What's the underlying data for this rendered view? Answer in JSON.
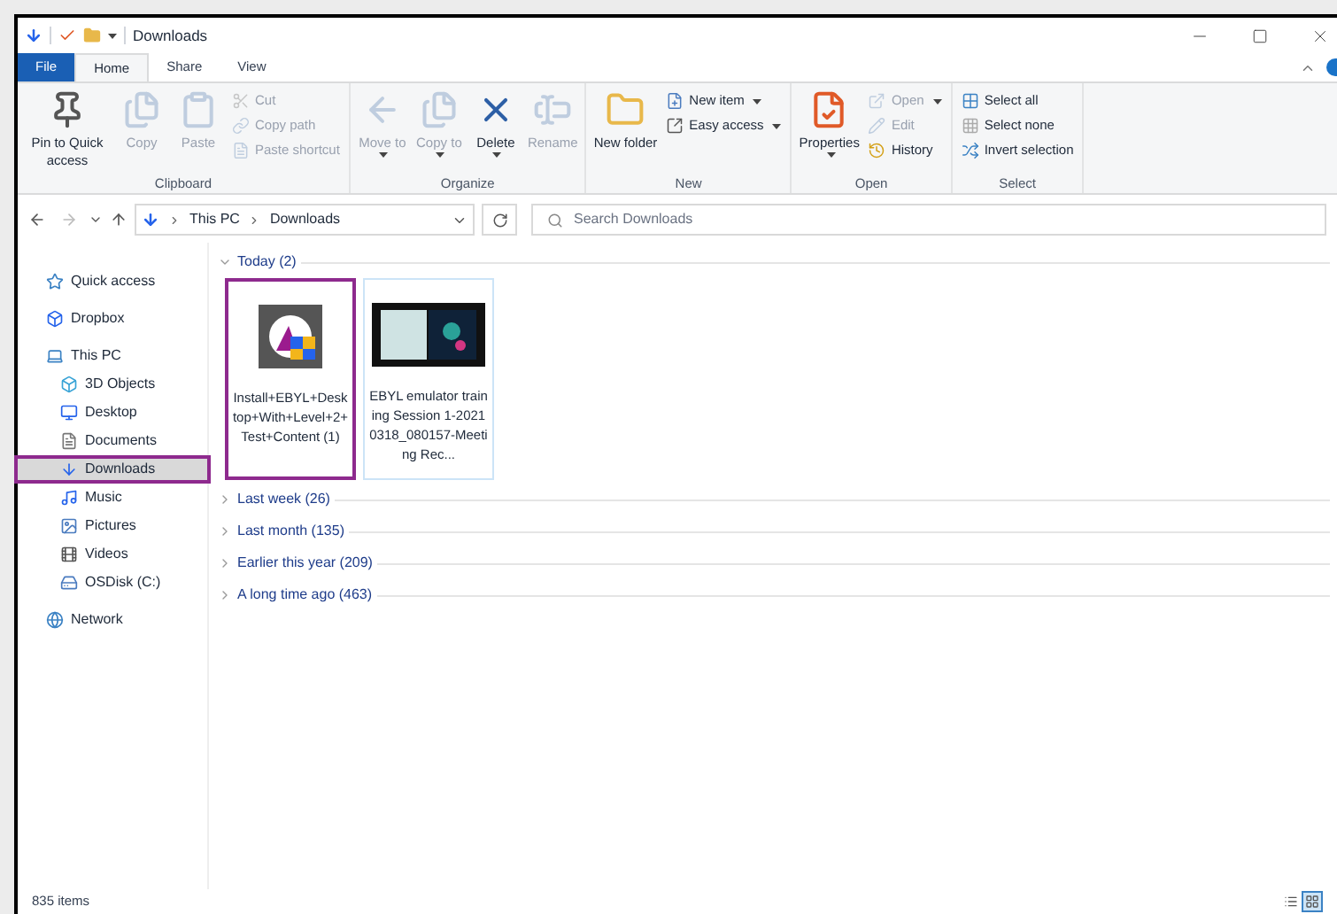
{
  "window": {
    "title": "Downloads"
  },
  "tabs": [
    {
      "label": "File",
      "kind": "file",
      "selected": false
    },
    {
      "label": "Home",
      "kind": "tab",
      "selected": true
    },
    {
      "label": "Share",
      "kind": "tab",
      "selected": false
    },
    {
      "label": "View",
      "kind": "tab",
      "selected": false
    }
  ],
  "ribbon": [
    {
      "name": "Clipboard",
      "items": [
        {
          "kind": "large",
          "label": "Pin to Quick access",
          "disabled": false,
          "dropdown": false
        },
        {
          "kind": "large",
          "label": "Copy",
          "disabled": true,
          "dropdown": false
        },
        {
          "kind": "large",
          "label": "Paste",
          "disabled": true,
          "dropdown": false
        },
        {
          "kind": "stack",
          "items": [
            {
              "label": "Cut",
              "disabled": true,
              "dropdown": false
            },
            {
              "label": "Copy path",
              "disabled": true,
              "dropdown": false
            },
            {
              "label": "Paste shortcut",
              "disabled": true,
              "dropdown": false
            }
          ]
        }
      ]
    },
    {
      "name": "Organize",
      "items": [
        {
          "kind": "large",
          "label": "Move to",
          "disabled": true,
          "dropdown": true
        },
        {
          "kind": "large",
          "label": "Copy to",
          "disabled": true,
          "dropdown": true
        },
        {
          "kind": "large",
          "label": "Delete",
          "disabled": false,
          "dropdown": true
        },
        {
          "kind": "large",
          "label": "Rename",
          "disabled": true,
          "dropdown": false
        }
      ]
    },
    {
      "name": "New",
      "items": [
        {
          "kind": "large",
          "label": "New folder",
          "disabled": false,
          "dropdown": false
        },
        {
          "kind": "stack",
          "items": [
            {
              "label": "New item",
              "disabled": false,
              "dropdown": true
            },
            {
              "label": "Easy access",
              "disabled": false,
              "dropdown": true
            }
          ]
        }
      ]
    },
    {
      "name": "Open",
      "items": [
        {
          "kind": "large",
          "label": "Properties",
          "disabled": false,
          "dropdown": true
        },
        {
          "kind": "stack",
          "items": [
            {
              "label": "Open",
              "disabled": true,
              "dropdown": true
            },
            {
              "label": "Edit",
              "disabled": true,
              "dropdown": false
            },
            {
              "label": "History",
              "disabled": false,
              "dropdown": false
            }
          ]
        }
      ]
    },
    {
      "name": "Select",
      "items": [
        {
          "kind": "stack",
          "items": [
            {
              "label": "Select all",
              "disabled": false,
              "dropdown": false
            },
            {
              "label": "Select none",
              "disabled": false,
              "dropdown": false
            },
            {
              "label": "Invert selection",
              "disabled": false,
              "dropdown": false
            }
          ]
        }
      ]
    }
  ],
  "address": {
    "path": [
      "This PC",
      "Downloads"
    ],
    "search_placeholder": "Search Downloads"
  },
  "sidebar": {
    "items": [
      {
        "label": "Quick access",
        "selected": false
      },
      {
        "label": "Dropbox",
        "selected": false
      },
      {
        "label": "This PC",
        "selected": false,
        "children": [
          {
            "label": "3D Objects",
            "selected": false
          },
          {
            "label": "Desktop",
            "selected": false
          },
          {
            "label": "Documents",
            "selected": false
          },
          {
            "label": "Downloads",
            "selected": true
          },
          {
            "label": "Music",
            "selected": false
          },
          {
            "label": "Pictures",
            "selected": false
          },
          {
            "label": "Videos",
            "selected": false
          },
          {
            "label": "OSDisk (C:)",
            "selected": false
          }
        ]
      },
      {
        "label": "Network",
        "selected": false
      }
    ]
  },
  "groups": [
    {
      "label": "Today (2)",
      "expanded": true,
      "files": [
        {
          "name": "Install+EBYL+Desktop+With+Level+2+Test+Content (1)",
          "kind": "app",
          "selected": true
        },
        {
          "name": "EBYL emulator training Session 1-20210318_080157-Meeting Rec...",
          "kind": "video",
          "selected": false
        }
      ]
    },
    {
      "label": "Last week (26)",
      "expanded": false
    },
    {
      "label": "Last month (135)",
      "expanded": false
    },
    {
      "label": "Earlier this year (209)",
      "expanded": false
    },
    {
      "label": "A long time ago (463)",
      "expanded": false
    }
  ],
  "status_bar": {
    "count": "835 items",
    "views": [
      {
        "kind": "details",
        "selected": false
      },
      {
        "kind": "icons",
        "selected": true
      }
    ]
  }
}
